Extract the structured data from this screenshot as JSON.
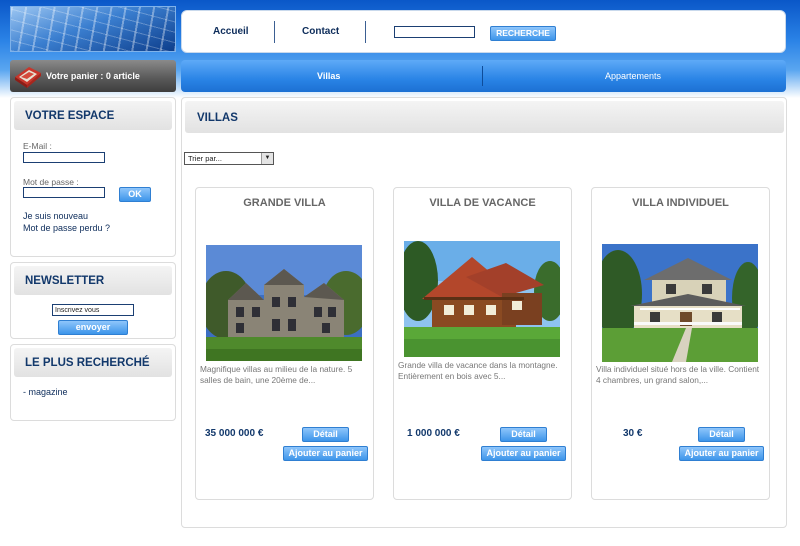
{
  "header": {
    "nav": [
      {
        "label": "Accueil"
      },
      {
        "label": "Contact"
      }
    ],
    "search_value": "",
    "search_button": "RECHERCHE"
  },
  "cart": {
    "label": "Votre panier : 0 article",
    "icon": "book-icon"
  },
  "category_nav": {
    "tabs": [
      {
        "label": "Villas",
        "active": true
      },
      {
        "label": "Appartements",
        "active": false
      }
    ]
  },
  "sidebar": {
    "espace": {
      "title": "VOTRE ESPACE",
      "email_label": "E-Mail :",
      "email_value": "",
      "password_label": "Mot de passe :",
      "password_value": "",
      "ok_button": "OK",
      "links": [
        "Je suis nouveau",
        "Mot de passe perdu ?"
      ]
    },
    "newsletter": {
      "title": "NEWSLETTER",
      "input_value": "Inscrivez vous",
      "button": "envoyer"
    },
    "most_searched": {
      "title": "LE PLUS RECHERCHÉ",
      "items": [
        "- magazine"
      ]
    }
  },
  "main": {
    "title": "VILLAS",
    "sort_value": "Trier par...",
    "products": [
      {
        "title": "GRANDE VILLA",
        "description": "Magnifique villas au milieu de la nature. 5 salles de bain, une 20ème de...",
        "price": "35 000 000 €",
        "detail_button": "Détail",
        "cart_button": "Ajouter au panier"
      },
      {
        "title": "VILLA DE VACANCE",
        "description": "Grande villa de vacance dans la montagne. Entièrement en bois avec 5...",
        "price": "1 000 000 €",
        "detail_button": "Détail",
        "cart_button": "Ajouter au panier"
      },
      {
        "title": "VILLA INDIVIDUEL",
        "description": "Villa individuel situé hors de la ville. Contient 4 chambres, un grand salon,...",
        "price": "30 €",
        "detail_button": "Détail",
        "cart_button": "Ajouter au panier"
      }
    ]
  },
  "colors": {
    "header_blue": "#0a57c8",
    "nav_blue": "#2a84e6",
    "heading_navy": "#12386b",
    "button_blue": "#3d95ea"
  }
}
